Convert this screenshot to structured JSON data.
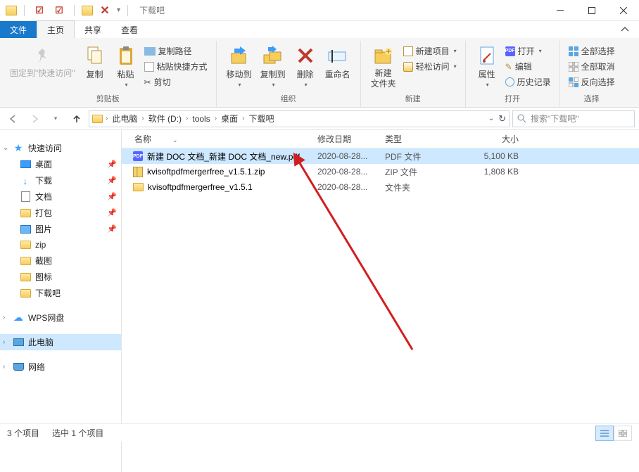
{
  "titlebar": {
    "title": "下载吧"
  },
  "tabs": {
    "file": "文件",
    "home": "主页",
    "share": "共享",
    "view": "查看"
  },
  "ribbon": {
    "clipboard": {
      "pin": "固定到\"快速访问\"",
      "copy": "复制",
      "paste": "粘贴",
      "copy_path": "复制路径",
      "paste_shortcut": "粘贴快捷方式",
      "cut": "剪切",
      "group": "剪贴板"
    },
    "organize": {
      "move_to": "移动到",
      "copy_to": "复制到",
      "delete": "删除",
      "rename": "重命名",
      "group": "组织"
    },
    "new": {
      "new_folder": "新建\n文件夹",
      "new_item": "新建项目",
      "easy_access": "轻松访问",
      "group": "新建"
    },
    "open": {
      "properties": "属性",
      "open": "打开",
      "edit": "编辑",
      "history": "历史记录",
      "group": "打开"
    },
    "select": {
      "select_all": "全部选择",
      "select_none": "全部取消",
      "invert": "反向选择",
      "group": "选择"
    }
  },
  "breadcrumb": [
    "此电脑",
    "软件 (D:)",
    "tools",
    "桌面",
    "下载吧"
  ],
  "search": {
    "placeholder": "搜索\"下载吧\""
  },
  "columns": {
    "name": "名称",
    "date": "修改日期",
    "type": "类型",
    "size": "大小"
  },
  "nav": {
    "quick_access": "快速访问",
    "items": [
      {
        "label": "桌面",
        "icon": "desktop",
        "pinned": true
      },
      {
        "label": "下载",
        "icon": "download",
        "pinned": true
      },
      {
        "label": "文档",
        "icon": "doc",
        "pinned": true
      },
      {
        "label": "打包",
        "icon": "folder",
        "pinned": true
      },
      {
        "label": "图片",
        "icon": "pic",
        "pinned": true
      },
      {
        "label": "zip",
        "icon": "folder",
        "pinned": false
      },
      {
        "label": "截图",
        "icon": "folder",
        "pinned": false
      },
      {
        "label": "图标",
        "icon": "folder",
        "pinned": false
      },
      {
        "label": "下载吧",
        "icon": "folder",
        "pinned": false
      }
    ],
    "wps": "WPS网盘",
    "this_pc": "此电脑",
    "network": "网络"
  },
  "files": [
    {
      "name": "新建 DOC 文档_新建 DOC 文档_new.pdf",
      "date": "2020-08-28...",
      "type": "PDF 文件",
      "size": "5,100 KB",
      "icon": "pdf",
      "selected": true
    },
    {
      "name": "kvisoftpdfmergerfree_v1.5.1.zip",
      "date": "2020-08-28...",
      "type": "ZIP 文件",
      "size": "1,808 KB",
      "icon": "zip",
      "selected": false
    },
    {
      "name": "kvisoftpdfmergerfree_v1.5.1",
      "date": "2020-08-28...",
      "type": "文件夹",
      "size": "",
      "icon": "folder",
      "selected": false
    }
  ],
  "status": {
    "count": "3 个项目",
    "selection": "选中 1 个项目"
  }
}
